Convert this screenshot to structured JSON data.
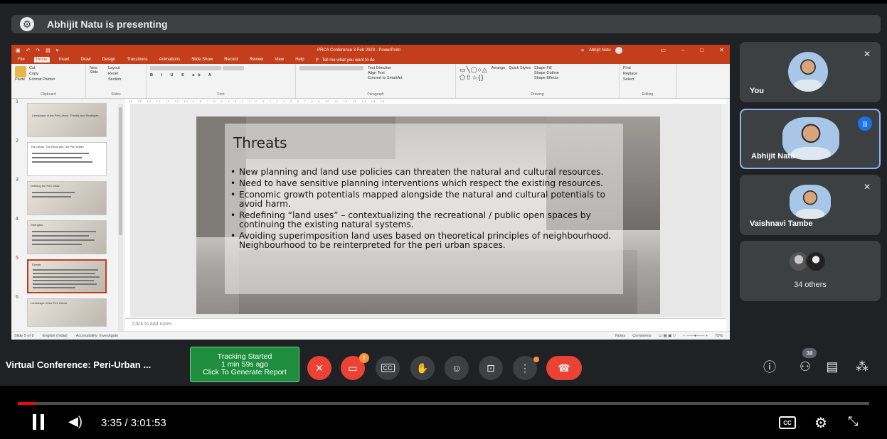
{
  "presenting_banner": {
    "text": "Abhijit Natu is presenting"
  },
  "ppt": {
    "window_title": "PRCA Conference 3 Feb 2023 - PowerPoint",
    "user_name": "Abhijit Natu",
    "menu": [
      "File",
      "Home",
      "Insert",
      "Draw",
      "Design",
      "Transitions",
      "Animations",
      "Slide Show",
      "Record",
      "Review",
      "View",
      "Help"
    ],
    "tell_me": "Tell me what you want to do",
    "ribbon": {
      "clipboard": {
        "paste": "Paste",
        "cut": "Cut",
        "copy": "Copy",
        "format_painter": "Format Painter",
        "label": "Clipboard"
      },
      "slides": {
        "new_slide": "New Slide",
        "layout": "Layout",
        "reset": "Reset",
        "section": "Section",
        "label": "Slides"
      },
      "font": {
        "label": "Font"
      },
      "paragraph": {
        "text_direction": "Text Direction",
        "align_text": "Align Text",
        "convert_smartart": "Convert to SmartArt",
        "label": "Paragraph"
      },
      "drawing": {
        "arrange": "Arrange",
        "quick_styles": "Quick Styles",
        "shape_fill": "Shape Fill",
        "shape_outline": "Shape Outline",
        "shape_effects": "Shape Effects",
        "label": "Drawing"
      },
      "editing": {
        "find": "Find",
        "replace": "Replace",
        "select": "Select",
        "label": "Editing"
      }
    },
    "thumbnails": [
      {
        "num": "1",
        "caption": "Landscape of the Peri Urban: Threats and Strategies"
      },
      {
        "num": "2",
        "caption": "The Urban, The Rural and The Peri Urban"
      },
      {
        "num": "3",
        "caption": "Defining the Peri Urban"
      },
      {
        "num": "4",
        "caption": "Strengths"
      },
      {
        "num": "5",
        "caption": "Threats"
      },
      {
        "num": "6",
        "caption": "Landscape of the Peri Urban"
      }
    ],
    "slide": {
      "title": "Threats",
      "bullets": [
        "New planning and land use policies can threaten the natural and cultural resources.",
        "Need to have sensitive planning interventions which respect the existing resources.",
        "Economic growth potentials mapped alongside the natural and cultural potentials to avoid harm.",
        "Redefining “land uses” – contextualizing the recreational / public open spaces by continuing the existing natural systems.",
        "Avoiding superimposition land uses based on theoretical principles of neighbourhood. Neighbourhood to be reinterpreted for the peri urban spaces."
      ]
    },
    "notes_placeholder": "Click to add notes",
    "status": {
      "slide": "Slide 5 of 9",
      "language": "English (India)",
      "accessibility": "Accessibility: Investigate",
      "notes": "Notes",
      "comments": "Comments",
      "zoom": "75%"
    }
  },
  "participants": [
    {
      "name": "You",
      "muted": true
    },
    {
      "name": "Abhijit Natu",
      "speaking": true
    },
    {
      "name": "Vaishnavi Tambe",
      "muted": true
    },
    {
      "name": "34 others"
    }
  ],
  "controls": {
    "meeting_name": "Virtual Conference: Peri-Urban ...",
    "tracking": {
      "line1": "Tracking Started",
      "line2": "1 min 59s ago",
      "line3": "Click To Generate Report"
    },
    "camera_badge": "!",
    "people_count": "38"
  },
  "player": {
    "time": "3:35 / 3:01:53",
    "progress": 0.02
  }
}
